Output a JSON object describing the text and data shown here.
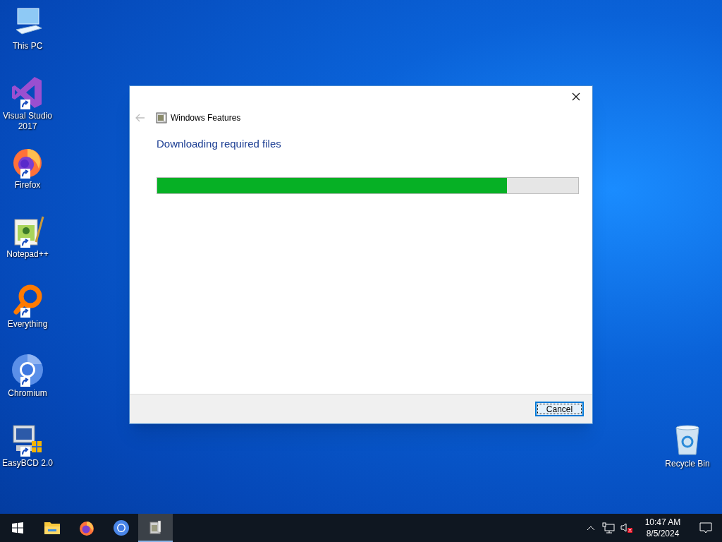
{
  "desktop_icons": [
    {
      "label": "This PC",
      "kind": "computer",
      "shortcut": false
    },
    {
      "label": "Visual Studio 2017",
      "kind": "vs",
      "shortcut": true
    },
    {
      "label": "Firefox",
      "kind": "firefox",
      "shortcut": true
    },
    {
      "label": "Notepad++",
      "kind": "notepad",
      "shortcut": true
    },
    {
      "label": "Everything",
      "kind": "everything",
      "shortcut": true
    },
    {
      "label": "Chromium",
      "kind": "chromium",
      "shortcut": true
    },
    {
      "label": "EasyBCD 2.0",
      "kind": "easybcd",
      "shortcut": true
    },
    {
      "label": "Recycle Bin",
      "kind": "recycle",
      "shortcut": false
    }
  ],
  "dialog": {
    "title": "Windows Features",
    "back": {
      "disabled": true
    },
    "heading": "Downloading required files",
    "progress": {
      "level": 0.83
    },
    "buttons": [
      {
        "label": "Cancel",
        "focused": true
      }
    ]
  },
  "taskbar": {
    "items": [
      {
        "kind": "start",
        "selected": false
      },
      {
        "kind": "folder",
        "selected": false
      },
      {
        "kind": "firefox",
        "selected": false
      },
      {
        "kind": "chromium",
        "selected": false
      },
      {
        "kind": "features",
        "selected": true
      }
    ],
    "tray": {
      "time": "10:47 AM",
      "date": "8/5/2024"
    }
  }
}
